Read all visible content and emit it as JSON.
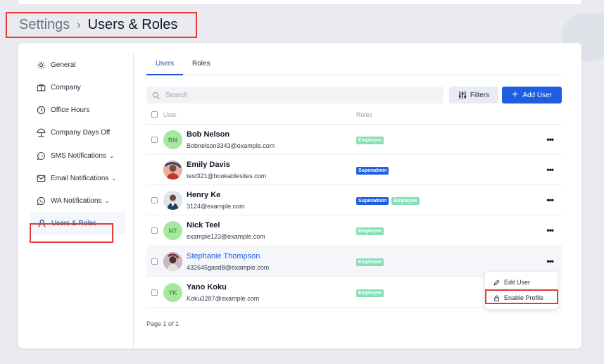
{
  "breadcrumb": {
    "root": "Settings",
    "separator": "›",
    "current": "Users & Roles"
  },
  "sidebar": {
    "items": [
      {
        "label": "General",
        "icon": "gear-icon"
      },
      {
        "label": "Company",
        "icon": "briefcase-icon"
      },
      {
        "label": "Office Hours",
        "icon": "clock-icon"
      },
      {
        "label": "Company Days Off",
        "icon": "umbrella-icon"
      },
      {
        "label": "SMS Notifications",
        "icon": "chat-icon",
        "chevron": "⌄"
      },
      {
        "label": "Email Notifications",
        "icon": "mail-icon",
        "chevron": "⌄"
      },
      {
        "label": "WA Notifications",
        "icon": "whatsapp-icon",
        "chevron": "⌄"
      },
      {
        "label": "Users & Roles",
        "icon": "user-icon",
        "active": true
      }
    ]
  },
  "tabs": [
    {
      "label": "Users",
      "active": true
    },
    {
      "label": "Roles"
    }
  ],
  "toolbar": {
    "search_placeholder": "Search",
    "filters_label": "Filters",
    "add_user_label": "Add User"
  },
  "table": {
    "header_user": "User",
    "header_roles": "Roles",
    "rows": [
      {
        "name": "Bob Nelson",
        "email": "Bobnelson3343@example.com",
        "initials": "BN",
        "roles": [
          "Employee"
        ]
      },
      {
        "name": "Emily Davis",
        "email": "test321@bookablesites.com",
        "roles": [
          "Superadmin"
        ]
      },
      {
        "name": "Henry Ke",
        "email": "3124@example.com",
        "roles": [
          "Superadmin",
          "Employee"
        ]
      },
      {
        "name": "Nick Teel",
        "email": "example123@example.com",
        "initials": "NT",
        "roles": [
          "Employee"
        ]
      },
      {
        "name": "Stephanie Thompson",
        "email": "432645gasd8@example.com",
        "roles": [
          "Employee"
        ]
      },
      {
        "name": "Yano Koku",
        "email": "Koku3287@example.com",
        "initials": "YK",
        "roles": [
          "Employee"
        ]
      }
    ],
    "actions_glyph": "•••"
  },
  "context_menu": {
    "edit_label": "Edit User",
    "enable_label": "Enable Profile"
  },
  "pagination": {
    "text": "Page 1 of 1"
  },
  "colors": {
    "accent": "#1d5fe0",
    "employee_badge": "#86e0b6",
    "highlight_border": "#e53935"
  }
}
